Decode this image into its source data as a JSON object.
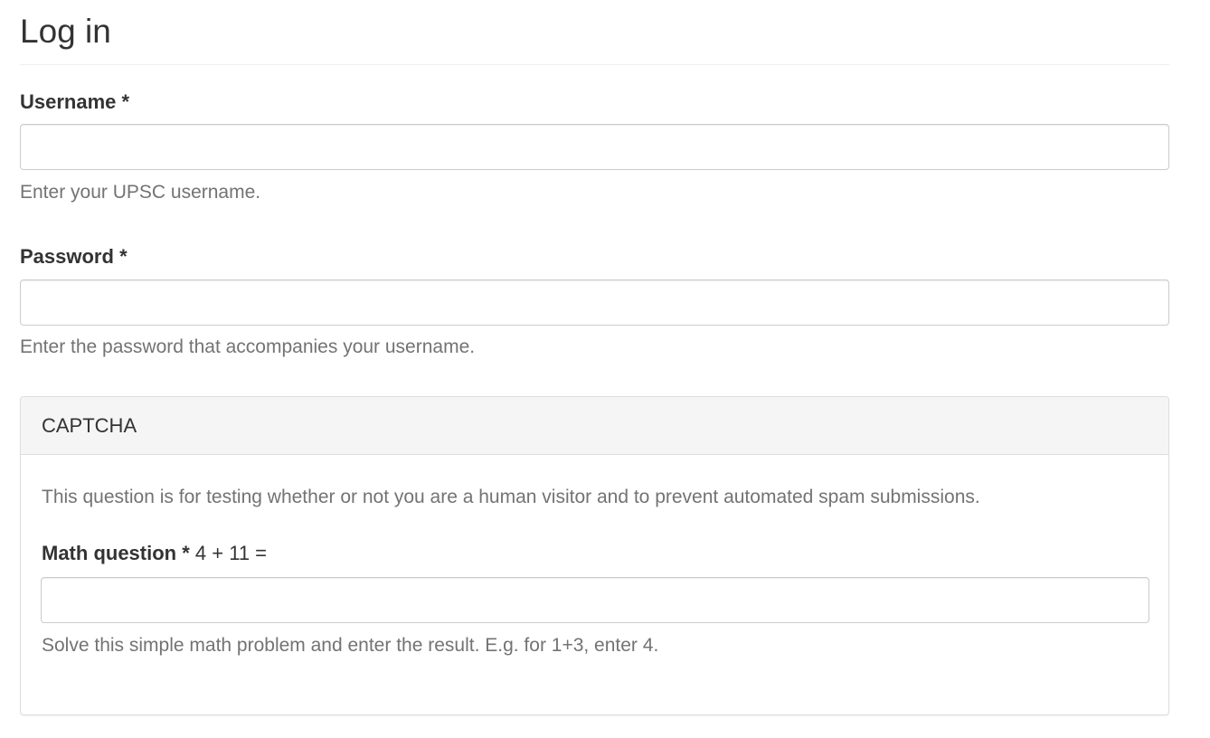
{
  "page": {
    "title": "Log in"
  },
  "username": {
    "label": "Username",
    "required_marker": "*",
    "value": "",
    "help": "Enter your UPSC username."
  },
  "password": {
    "label": "Password",
    "required_marker": "*",
    "value": "",
    "help": "Enter the password that accompanies your username."
  },
  "captcha": {
    "title": "CAPTCHA",
    "description": "This question is for testing whether or not you are a human visitor and to prevent automated spam submissions.",
    "math_label": "Math question",
    "required_marker": "*",
    "math_question": "4 + 11 =",
    "value": "",
    "help": "Solve this simple math problem and enter the result. E.g. for 1+3, enter 4."
  }
}
